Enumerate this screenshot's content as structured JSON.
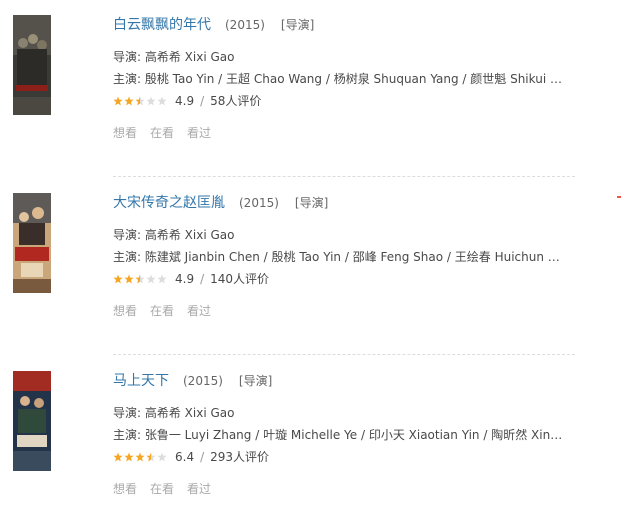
{
  "colors": {
    "link": "#3377aa",
    "star_on": "#f5a623",
    "star_off": "#dddddd",
    "muted": "#aaaaaa"
  },
  "items": [
    {
      "title": "白云飘飘的年代",
      "year": "(2015)",
      "role": "[导演]",
      "director": "导演: 高希希 Xixi Gao",
      "cast": "主演: 殷桃 Tao Yin / 王超 Chao Wang / 杨树泉 Shuquan Yang / 颜世魁 Shikui Yan ...",
      "rating": "4.9",
      "rating_stars": 2.5,
      "reviews": "58人评价",
      "slash": "/",
      "actions": [
        "想看",
        "在看",
        "看过"
      ]
    },
    {
      "title": "大宋传奇之赵匡胤",
      "year": "(2015)",
      "role": "[导演]",
      "director": "导演: 高希希 Xixi Gao",
      "cast": "主演: 陈建斌 Jianbin Chen / 殷桃 Tao Yin / 邵峰 Feng Shao / 王绘春 Huichun Wan...",
      "rating": "4.9",
      "rating_stars": 2.5,
      "reviews": "140人评价",
      "slash": "/",
      "actions": [
        "想看",
        "在看",
        "看过"
      ]
    },
    {
      "title": "马上天下",
      "year": "(2015)",
      "role": "[导演]",
      "director": "导演: 高希希 Xixi Gao",
      "cast": "主演: 张鲁一 Luyi Zhang / 叶璇 Michelle Ye / 印小天 Xiaotian Yin / 陶昕然 Xinr...",
      "rating": "6.4",
      "rating_stars": 3.5,
      "reviews": "293人评价",
      "slash": "/",
      "actions": [
        "想看",
        "在看",
        "看过"
      ]
    }
  ]
}
